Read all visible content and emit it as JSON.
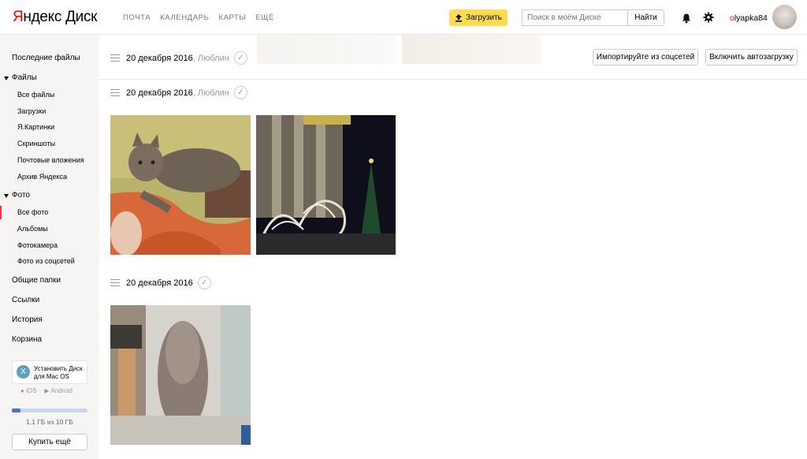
{
  "header": {
    "logo_part1": "Я",
    "logo_part2": "ндекс Диск",
    "nav": [
      "ПОЧТА",
      "КАЛЕНДАРЬ",
      "КАРТЫ",
      "ЕЩЁ"
    ],
    "upload_label": "Загрузить",
    "search_placeholder": "Поиск в моём Диске",
    "search_button": "Найти",
    "username_first": "o",
    "username_rest": "lyapka84"
  },
  "sidebar": {
    "recent": "Последние файлы",
    "files": "Файлы",
    "files_items": [
      "Все файлы",
      "Загрузки",
      "Я.Картинки",
      "Скриншоты",
      "Почтовые вложения",
      "Архив Яндекса"
    ],
    "photo": "Фото",
    "photo_items": [
      "Все фото",
      "Альбомы",
      "Фотокамера",
      "Фото из соцсетей"
    ],
    "shared": "Общие папки",
    "links": "Ссылки",
    "history": "История",
    "trash": "Корзина",
    "install_line1": "Установить Диск",
    "install_line2": "для Mac OS",
    "install_icon_glyph": "X",
    "ios": "iOS",
    "android": "Android",
    "storage_text": "1,1 ГБ из 10 ГБ",
    "storage_used_fraction": 0.11,
    "buy_more": "Купить ещё"
  },
  "main": {
    "import_button": "Импортируйте из соцсетей",
    "autoload_button": "Включить автозагрузку",
    "groups": [
      {
        "date": "20 декабря 2016",
        "location": ", Люблин"
      },
      {
        "date": "20 декабря 2016",
        "location": ", Люблин"
      },
      {
        "date": "20 декабря 2016",
        "location": ""
      }
    ],
    "check_glyph": "✓"
  },
  "colors": {
    "accent_yellow": "#ffdb4d",
    "brand_red": "#ff0000",
    "sidebar_bg": "#f6f5f3",
    "storage_fill": "#4a75c7"
  }
}
